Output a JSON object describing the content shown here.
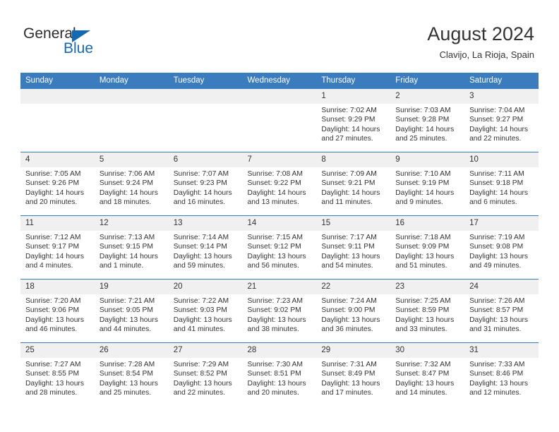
{
  "brand": {
    "name_top": "General",
    "name_bottom": "Blue",
    "triangle_color": "#1569b0",
    "text_color": "#2b2b2b"
  },
  "header": {
    "month_title": "August 2024",
    "location": "Clavijo, La Rioja, Spain"
  },
  "theme": {
    "header_blue": "#3a7cbe",
    "daynum_band": "#f0f0f0",
    "text": "#333333"
  },
  "weekdays": [
    "Sunday",
    "Monday",
    "Tuesday",
    "Wednesday",
    "Thursday",
    "Friday",
    "Saturday"
  ],
  "labels": {
    "sunrise_prefix": "Sunrise:",
    "sunset_prefix": "Sunset:",
    "daylight_prefix": "Daylight:"
  },
  "weeks": [
    [
      {
        "day": "",
        "empty": true
      },
      {
        "day": "",
        "empty": true
      },
      {
        "day": "",
        "empty": true
      },
      {
        "day": "",
        "empty": true
      },
      {
        "day": "1",
        "sunrise": "Sunrise: 7:02 AM",
        "sunset": "Sunset: 9:29 PM",
        "daylight": "Daylight: 14 hours and 27 minutes."
      },
      {
        "day": "2",
        "sunrise": "Sunrise: 7:03 AM",
        "sunset": "Sunset: 9:28 PM",
        "daylight": "Daylight: 14 hours and 25 minutes."
      },
      {
        "day": "3",
        "sunrise": "Sunrise: 7:04 AM",
        "sunset": "Sunset: 9:27 PM",
        "daylight": "Daylight: 14 hours and 22 minutes."
      }
    ],
    [
      {
        "day": "4",
        "sunrise": "Sunrise: 7:05 AM",
        "sunset": "Sunset: 9:26 PM",
        "daylight": "Daylight: 14 hours and 20 minutes."
      },
      {
        "day": "5",
        "sunrise": "Sunrise: 7:06 AM",
        "sunset": "Sunset: 9:24 PM",
        "daylight": "Daylight: 14 hours and 18 minutes."
      },
      {
        "day": "6",
        "sunrise": "Sunrise: 7:07 AM",
        "sunset": "Sunset: 9:23 PM",
        "daylight": "Daylight: 14 hours and 16 minutes."
      },
      {
        "day": "7",
        "sunrise": "Sunrise: 7:08 AM",
        "sunset": "Sunset: 9:22 PM",
        "daylight": "Daylight: 14 hours and 13 minutes."
      },
      {
        "day": "8",
        "sunrise": "Sunrise: 7:09 AM",
        "sunset": "Sunset: 9:21 PM",
        "daylight": "Daylight: 14 hours and 11 minutes."
      },
      {
        "day": "9",
        "sunrise": "Sunrise: 7:10 AM",
        "sunset": "Sunset: 9:19 PM",
        "daylight": "Daylight: 14 hours and 9 minutes."
      },
      {
        "day": "10",
        "sunrise": "Sunrise: 7:11 AM",
        "sunset": "Sunset: 9:18 PM",
        "daylight": "Daylight: 14 hours and 6 minutes."
      }
    ],
    [
      {
        "day": "11",
        "sunrise": "Sunrise: 7:12 AM",
        "sunset": "Sunset: 9:17 PM",
        "daylight": "Daylight: 14 hours and 4 minutes."
      },
      {
        "day": "12",
        "sunrise": "Sunrise: 7:13 AM",
        "sunset": "Sunset: 9:15 PM",
        "daylight": "Daylight: 14 hours and 1 minute."
      },
      {
        "day": "13",
        "sunrise": "Sunrise: 7:14 AM",
        "sunset": "Sunset: 9:14 PM",
        "daylight": "Daylight: 13 hours and 59 minutes."
      },
      {
        "day": "14",
        "sunrise": "Sunrise: 7:15 AM",
        "sunset": "Sunset: 9:12 PM",
        "daylight": "Daylight: 13 hours and 56 minutes."
      },
      {
        "day": "15",
        "sunrise": "Sunrise: 7:17 AM",
        "sunset": "Sunset: 9:11 PM",
        "daylight": "Daylight: 13 hours and 54 minutes."
      },
      {
        "day": "16",
        "sunrise": "Sunrise: 7:18 AM",
        "sunset": "Sunset: 9:09 PM",
        "daylight": "Daylight: 13 hours and 51 minutes."
      },
      {
        "day": "17",
        "sunrise": "Sunrise: 7:19 AM",
        "sunset": "Sunset: 9:08 PM",
        "daylight": "Daylight: 13 hours and 49 minutes."
      }
    ],
    [
      {
        "day": "18",
        "sunrise": "Sunrise: 7:20 AM",
        "sunset": "Sunset: 9:06 PM",
        "daylight": "Daylight: 13 hours and 46 minutes."
      },
      {
        "day": "19",
        "sunrise": "Sunrise: 7:21 AM",
        "sunset": "Sunset: 9:05 PM",
        "daylight": "Daylight: 13 hours and 44 minutes."
      },
      {
        "day": "20",
        "sunrise": "Sunrise: 7:22 AM",
        "sunset": "Sunset: 9:03 PM",
        "daylight": "Daylight: 13 hours and 41 minutes."
      },
      {
        "day": "21",
        "sunrise": "Sunrise: 7:23 AM",
        "sunset": "Sunset: 9:02 PM",
        "daylight": "Daylight: 13 hours and 38 minutes."
      },
      {
        "day": "22",
        "sunrise": "Sunrise: 7:24 AM",
        "sunset": "Sunset: 9:00 PM",
        "daylight": "Daylight: 13 hours and 36 minutes."
      },
      {
        "day": "23",
        "sunrise": "Sunrise: 7:25 AM",
        "sunset": "Sunset: 8:59 PM",
        "daylight": "Daylight: 13 hours and 33 minutes."
      },
      {
        "day": "24",
        "sunrise": "Sunrise: 7:26 AM",
        "sunset": "Sunset: 8:57 PM",
        "daylight": "Daylight: 13 hours and 31 minutes."
      }
    ],
    [
      {
        "day": "25",
        "sunrise": "Sunrise: 7:27 AM",
        "sunset": "Sunset: 8:55 PM",
        "daylight": "Daylight: 13 hours and 28 minutes."
      },
      {
        "day": "26",
        "sunrise": "Sunrise: 7:28 AM",
        "sunset": "Sunset: 8:54 PM",
        "daylight": "Daylight: 13 hours and 25 minutes."
      },
      {
        "day": "27",
        "sunrise": "Sunrise: 7:29 AM",
        "sunset": "Sunset: 8:52 PM",
        "daylight": "Daylight: 13 hours and 22 minutes."
      },
      {
        "day": "28",
        "sunrise": "Sunrise: 7:30 AM",
        "sunset": "Sunset: 8:51 PM",
        "daylight": "Daylight: 13 hours and 20 minutes."
      },
      {
        "day": "29",
        "sunrise": "Sunrise: 7:31 AM",
        "sunset": "Sunset: 8:49 PM",
        "daylight": "Daylight: 13 hours and 17 minutes."
      },
      {
        "day": "30",
        "sunrise": "Sunrise: 7:32 AM",
        "sunset": "Sunset: 8:47 PM",
        "daylight": "Daylight: 13 hours and 14 minutes."
      },
      {
        "day": "31",
        "sunrise": "Sunrise: 7:33 AM",
        "sunset": "Sunset: 8:46 PM",
        "daylight": "Daylight: 13 hours and 12 minutes."
      }
    ]
  ]
}
